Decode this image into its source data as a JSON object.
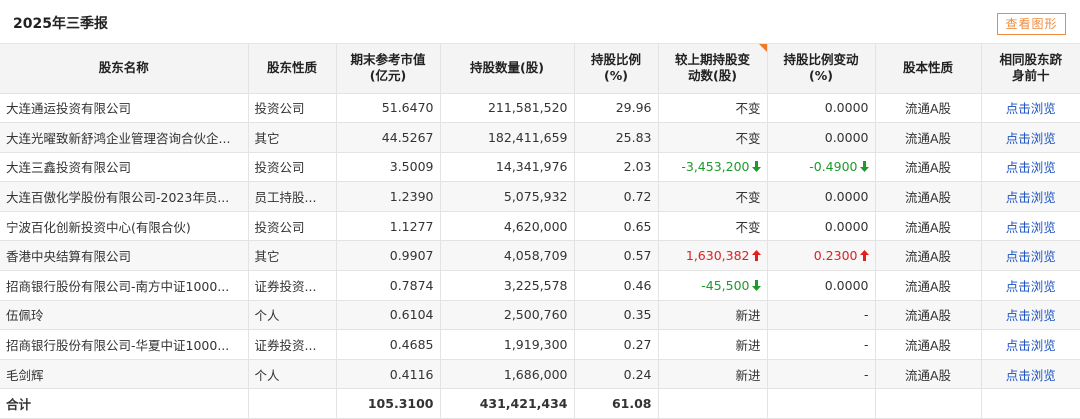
{
  "header": {
    "period": "2025年三季报",
    "chart_button": "查看图形"
  },
  "columns": {
    "name": "股东名称",
    "nature": "股东性质",
    "mv_line1": "期末参考市值",
    "mv_line2": "(亿元)",
    "shares": "持股数量(股)",
    "ratio_line1": "持股比例",
    "ratio_line2": "(%)",
    "change_line1": "较上期持股变",
    "change_line2": "动数(股)",
    "ratio_change_line1": "持股比例变动",
    "ratio_change_line2": "(%)",
    "share_type": "股本性质",
    "same_line1": "相同股东跻",
    "same_line2": "身前十"
  },
  "rows": [
    {
      "name": "大连通运投资有限公司",
      "nature": "投资公司",
      "mv": "51.6470",
      "shares": "211,581,520",
      "ratio": "29.96",
      "change": "不变",
      "ratio_change": "0.0000",
      "share_type": "流通A股",
      "link": "点击浏览"
    },
    {
      "name": "大连光曜致新舒鸿企业管理咨询合伙企...",
      "nature": "其它",
      "mv": "44.5267",
      "shares": "182,411,659",
      "ratio": "25.83",
      "change": "不变",
      "ratio_change": "0.0000",
      "share_type": "流通A股",
      "link": "点击浏览"
    },
    {
      "name": "大连三鑫投资有限公司",
      "nature": "投资公司",
      "mv": "3.5009",
      "shares": "14,341,976",
      "ratio": "2.03",
      "change": "-3,453,200",
      "change_dir": "down",
      "ratio_change": "-0.4900",
      "ratio_change_dir": "down",
      "share_type": "流通A股",
      "link": "点击浏览"
    },
    {
      "name": "大连百傲化学股份有限公司-2023年员...",
      "nature": "员工持股...",
      "mv": "1.2390",
      "shares": "5,075,932",
      "ratio": "0.72",
      "change": "不变",
      "ratio_change": "0.0000",
      "share_type": "流通A股",
      "link": "点击浏览"
    },
    {
      "name": "宁波百化创新投资中心(有限合伙)",
      "nature": "投资公司",
      "mv": "1.1277",
      "shares": "4,620,000",
      "ratio": "0.65",
      "change": "不变",
      "ratio_change": "0.0000",
      "share_type": "流通A股",
      "link": "点击浏览"
    },
    {
      "name": "香港中央结算有限公司",
      "nature": "其它",
      "mv": "0.9907",
      "shares": "4,058,709",
      "ratio": "0.57",
      "change": "1,630,382",
      "change_dir": "up",
      "ratio_change": "0.2300",
      "ratio_change_dir": "up",
      "share_type": "流通A股",
      "link": "点击浏览"
    },
    {
      "name": "招商银行股份有限公司-南方中证1000...",
      "nature": "证券投资...",
      "mv": "0.7874",
      "shares": "3,225,578",
      "ratio": "0.46",
      "change": "-45,500",
      "change_dir": "down",
      "ratio_change": "0.0000",
      "share_type": "流通A股",
      "link": "点击浏览"
    },
    {
      "name": "伍佩玲",
      "nature": "个人",
      "mv": "0.6104",
      "shares": "2,500,760",
      "ratio": "0.35",
      "change": "新进",
      "ratio_change": "-",
      "share_type": "流通A股",
      "link": "点击浏览"
    },
    {
      "name": "招商银行股份有限公司-华夏中证1000...",
      "nature": "证券投资...",
      "mv": "0.4685",
      "shares": "1,919,300",
      "ratio": "0.27",
      "change": "新进",
      "ratio_change": "-",
      "share_type": "流通A股",
      "link": "点击浏览"
    },
    {
      "name": "毛剑辉",
      "nature": "个人",
      "mv": "0.4116",
      "shares": "1,686,000",
      "ratio": "0.24",
      "change": "新进",
      "ratio_change": "-",
      "share_type": "流通A股",
      "link": "点击浏览"
    }
  ],
  "total": {
    "label": "合计",
    "mv": "105.3100",
    "shares": "431,421,434",
    "ratio": "61.08"
  },
  "colors": {
    "accent": "#f08b3e",
    "up": "#e0201c",
    "down": "#1e9a2a",
    "link": "#1a51c2"
  }
}
